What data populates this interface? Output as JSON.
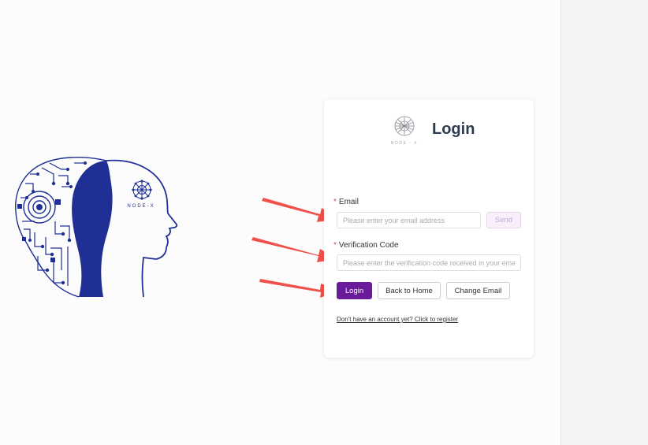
{
  "illustration": {
    "brand": "NODE-X"
  },
  "login": {
    "brand": "NODE - X",
    "title": "Login",
    "email_label": "Email",
    "email_placeholder": "Please enter your email address",
    "email_value": "",
    "send_label": "Send",
    "code_label": "Verification Code",
    "code_placeholder": "Please enter the verification code received in your email",
    "code_value": "",
    "required_mark": "*",
    "login_label": "Login",
    "back_label": "Back to Home",
    "change_email_label": "Change Email",
    "register_link": "Don't have an account yet? Click to register"
  },
  "colors": {
    "primary": "#6a1b9a",
    "illustration_blue": "#1f2f95",
    "arrow": "#f0504a",
    "title": "#2d3b4e"
  }
}
